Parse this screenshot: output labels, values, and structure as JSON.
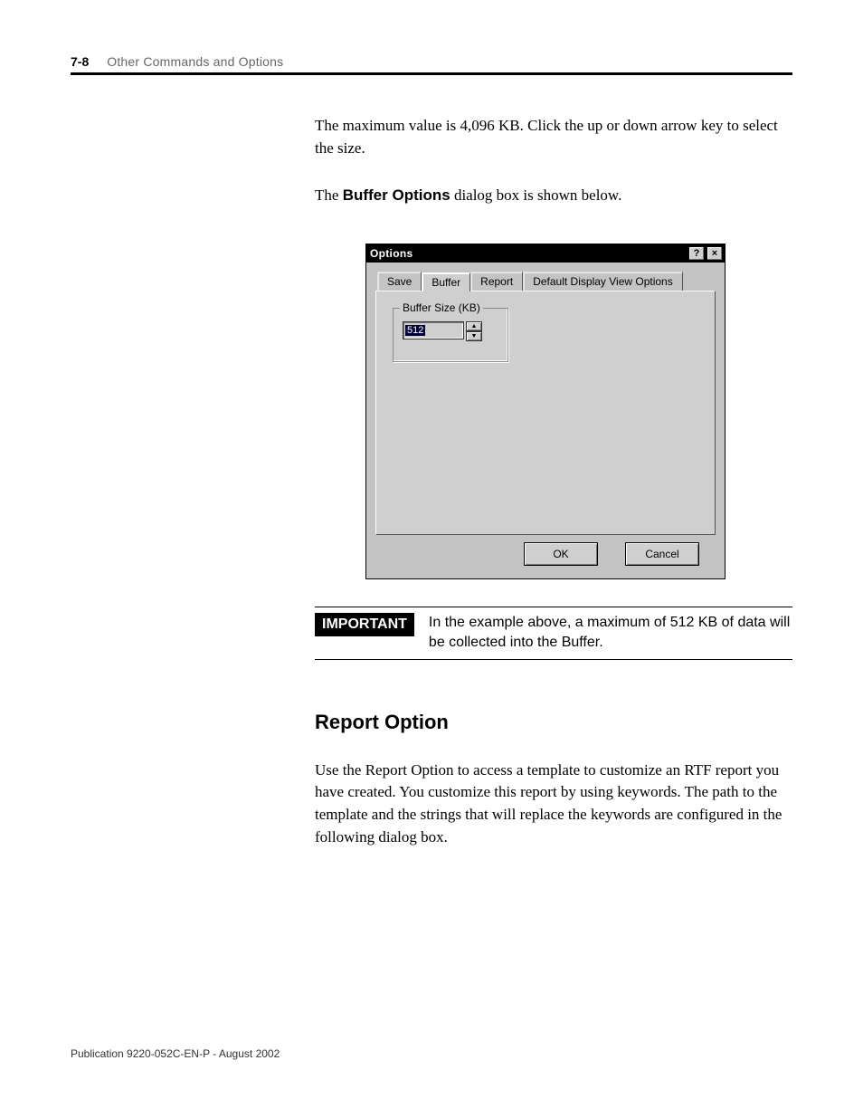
{
  "header": {
    "page_num": "7-8",
    "chapter_title": "Other Commands and Options"
  },
  "body": {
    "para1": "The maximum value is 4,096 KB. Click the up or down arrow key to select the size.",
    "para2_pre": "The ",
    "para2_bold": "Buffer Options",
    "para2_post": " dialog box is shown below."
  },
  "dialog": {
    "title": "Options",
    "help_btn": "?",
    "close_btn": "×",
    "tabs": {
      "save": "Save",
      "buffer": "Buffer",
      "report": "Report",
      "display": "Default Display View Options"
    },
    "group_legend": "Buffer Size (KB)",
    "spinner_value": "512",
    "up": "▲",
    "down": "▼",
    "ok": "OK",
    "cancel": "Cancel"
  },
  "important": {
    "label": "IMPORTANT",
    "text": "In the example above, a maximum of 512 KB of data will be collected into the Buffer."
  },
  "section": {
    "title": "Report Option",
    "para": "Use the Report Option to access a template to customize an RTF report you have created. You customize this report by using keywords. The path to the template and the strings that will replace the keywords are configured in the following dialog box."
  },
  "footer": {
    "pubid": "Publication 9220-052C-EN-P - August 2002"
  }
}
